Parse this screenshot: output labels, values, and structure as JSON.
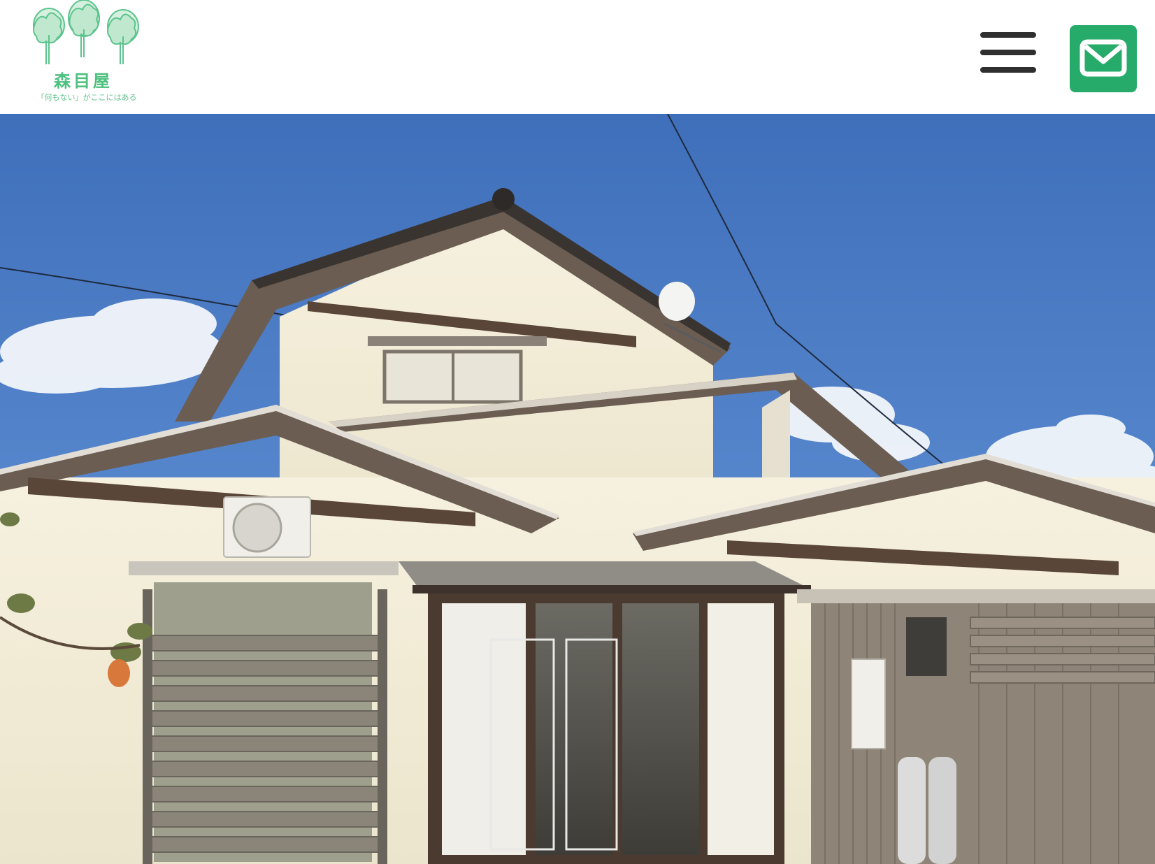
{
  "header": {
    "logo": {
      "name": "森目屋",
      "tagline": "「何もない」がここにはある",
      "icon": "three-trees-logo"
    },
    "menu_button": {
      "icon": "hamburger-menu-icon"
    },
    "mail_button": {
      "icon": "envelope-icon",
      "color": "#27ab6a"
    }
  },
  "hero": {
    "image": "traditional-japanese-house-photo",
    "colors": {
      "sky": "#4a7cc0",
      "wall": "#f4efdc",
      "roof_trim": "#5e4c40"
    }
  }
}
